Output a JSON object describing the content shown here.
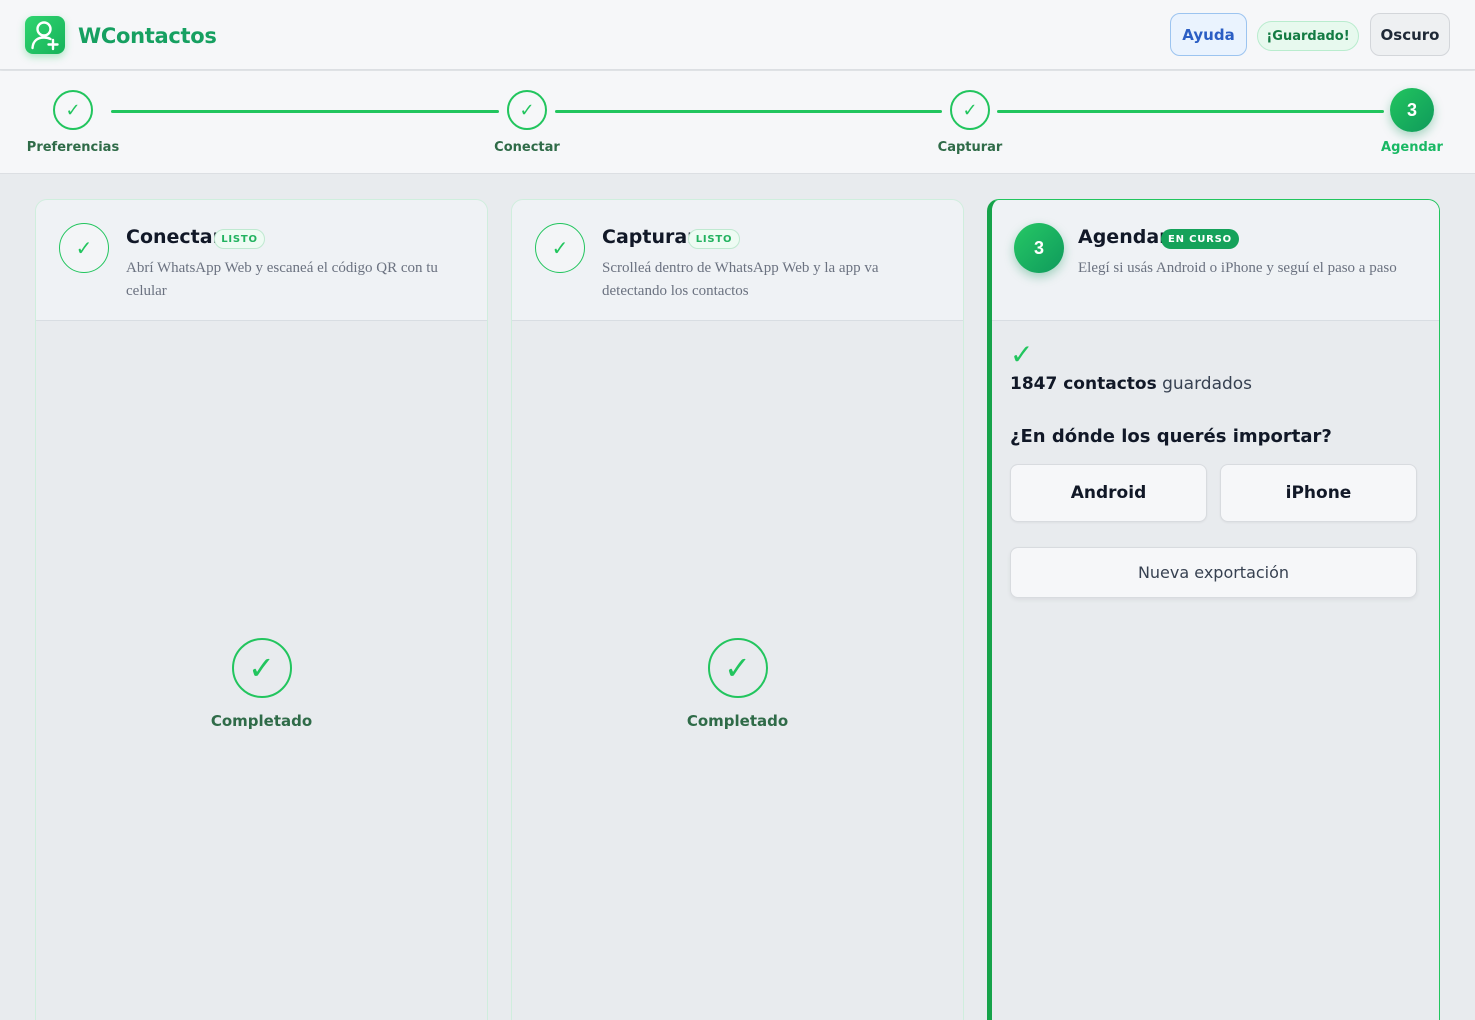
{
  "header": {
    "brand": "WContactos",
    "help_label": "Ayuda",
    "saved_label": "¡Guardado!",
    "theme_label": "Oscuro"
  },
  "stepper": {
    "steps": [
      {
        "label": "Preferencias",
        "state": "done",
        "mark": "✓"
      },
      {
        "label": "Conectar",
        "state": "done",
        "mark": "✓"
      },
      {
        "label": "Capturar",
        "state": "done",
        "mark": "✓"
      },
      {
        "label": "Agendar",
        "state": "active",
        "mark": "3"
      }
    ]
  },
  "cards": [
    {
      "title": "Conectar",
      "tag": "LISTO",
      "mark": "✓",
      "description": "Abrí WhatsApp Web y escaneá el código QR con tu celular",
      "done_mark": "✓",
      "done_label": "Completado"
    },
    {
      "title": "Capturar",
      "tag": "LISTO",
      "mark": "✓",
      "description": "Scrolleá dentro de WhatsApp Web y la app va detectando los contactos",
      "done_mark": "✓",
      "done_label": "Completado"
    },
    {
      "title": "Agendar",
      "tag": "EN CURSO",
      "mark": "3",
      "description": "Elegí si usás Android o iPhone y seguí el paso a paso",
      "check_mark": "✓",
      "count_bold": "1847 contactos",
      "count_rest": " guardados",
      "question": "¿En dónde los querés importar?",
      "options": [
        "Android",
        "iPhone"
      ],
      "new_export_label": "Nueva exportación"
    }
  ],
  "colors": {
    "accent": "#22c55e",
    "accent_dark": "#0f9a5c",
    "brand_text": "#16a061",
    "help_blue": "#2b5ec4"
  },
  "icons": {
    "logo": "user-plus-icon",
    "step_done": "check-icon"
  }
}
